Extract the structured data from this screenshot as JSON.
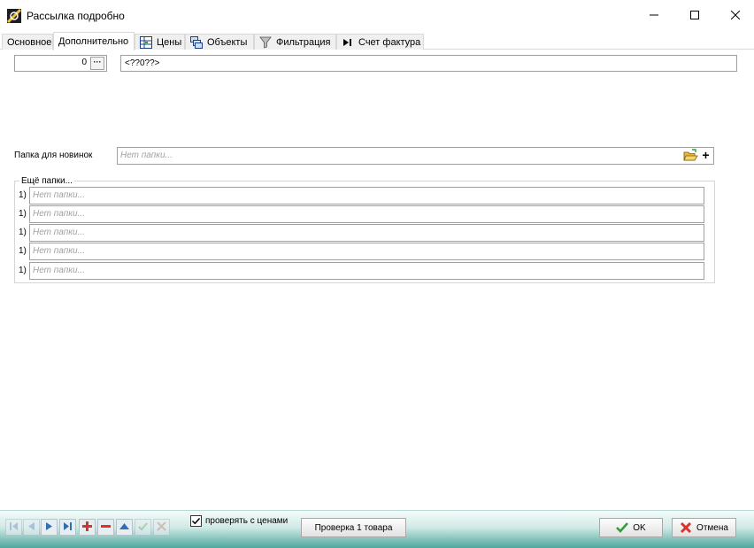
{
  "window": {
    "title": "Рассылка подробно",
    "icons": {
      "app": "app-logo-icon",
      "minimize": "minimize-icon",
      "maximize": "maximize-icon",
      "close": "close-icon"
    }
  },
  "tabs": [
    {
      "label": "Основное",
      "active": false,
      "icon": null
    },
    {
      "label": "Дополнительно",
      "active": true,
      "icon": null
    },
    {
      "label": "Цены",
      "active": false,
      "icon": "price-table-icon"
    },
    {
      "label": "Объекты",
      "active": false,
      "icon": "objects-icon"
    },
    {
      "label": "Фильтрация",
      "active": false,
      "icon": "funnel-icon"
    },
    {
      "label": "Счет фактура",
      "active": false,
      "icon": "play-end-icon"
    }
  ],
  "top_row": {
    "number_value": "0",
    "dots_label": "···",
    "text_value": "<??0??>"
  },
  "new_items_folder": {
    "label": "Папка для новинок",
    "placeholder": "Нет папки...",
    "add_label": "+"
  },
  "more_folders": {
    "title": "Ещё папки...",
    "rows": [
      {
        "num": "1)",
        "placeholder": "Нет папки..."
      },
      {
        "num": "1)",
        "placeholder": "Нет папки..."
      },
      {
        "num": "1)",
        "placeholder": "Нет папки..."
      },
      {
        "num": "1)",
        "placeholder": "Нет папки..."
      },
      {
        "num": "1)",
        "placeholder": "Нет папки..."
      }
    ]
  },
  "bottom_bar": {
    "navigator": [
      "first",
      "prior",
      "next",
      "last",
      "insert",
      "delete",
      "edit",
      "post",
      "cancel"
    ],
    "check_prices": {
      "label": "проверять с ценами",
      "checked": true
    },
    "check_button": "Проверка 1 товара",
    "ok_button": "OK",
    "cancel_button": "Отмена"
  },
  "colors": {
    "accent_green": "#2f9d3a",
    "delete_red": "#d9342b",
    "nav_blue": "#2f6fb3",
    "footer_teal": "#4fa79d"
  }
}
